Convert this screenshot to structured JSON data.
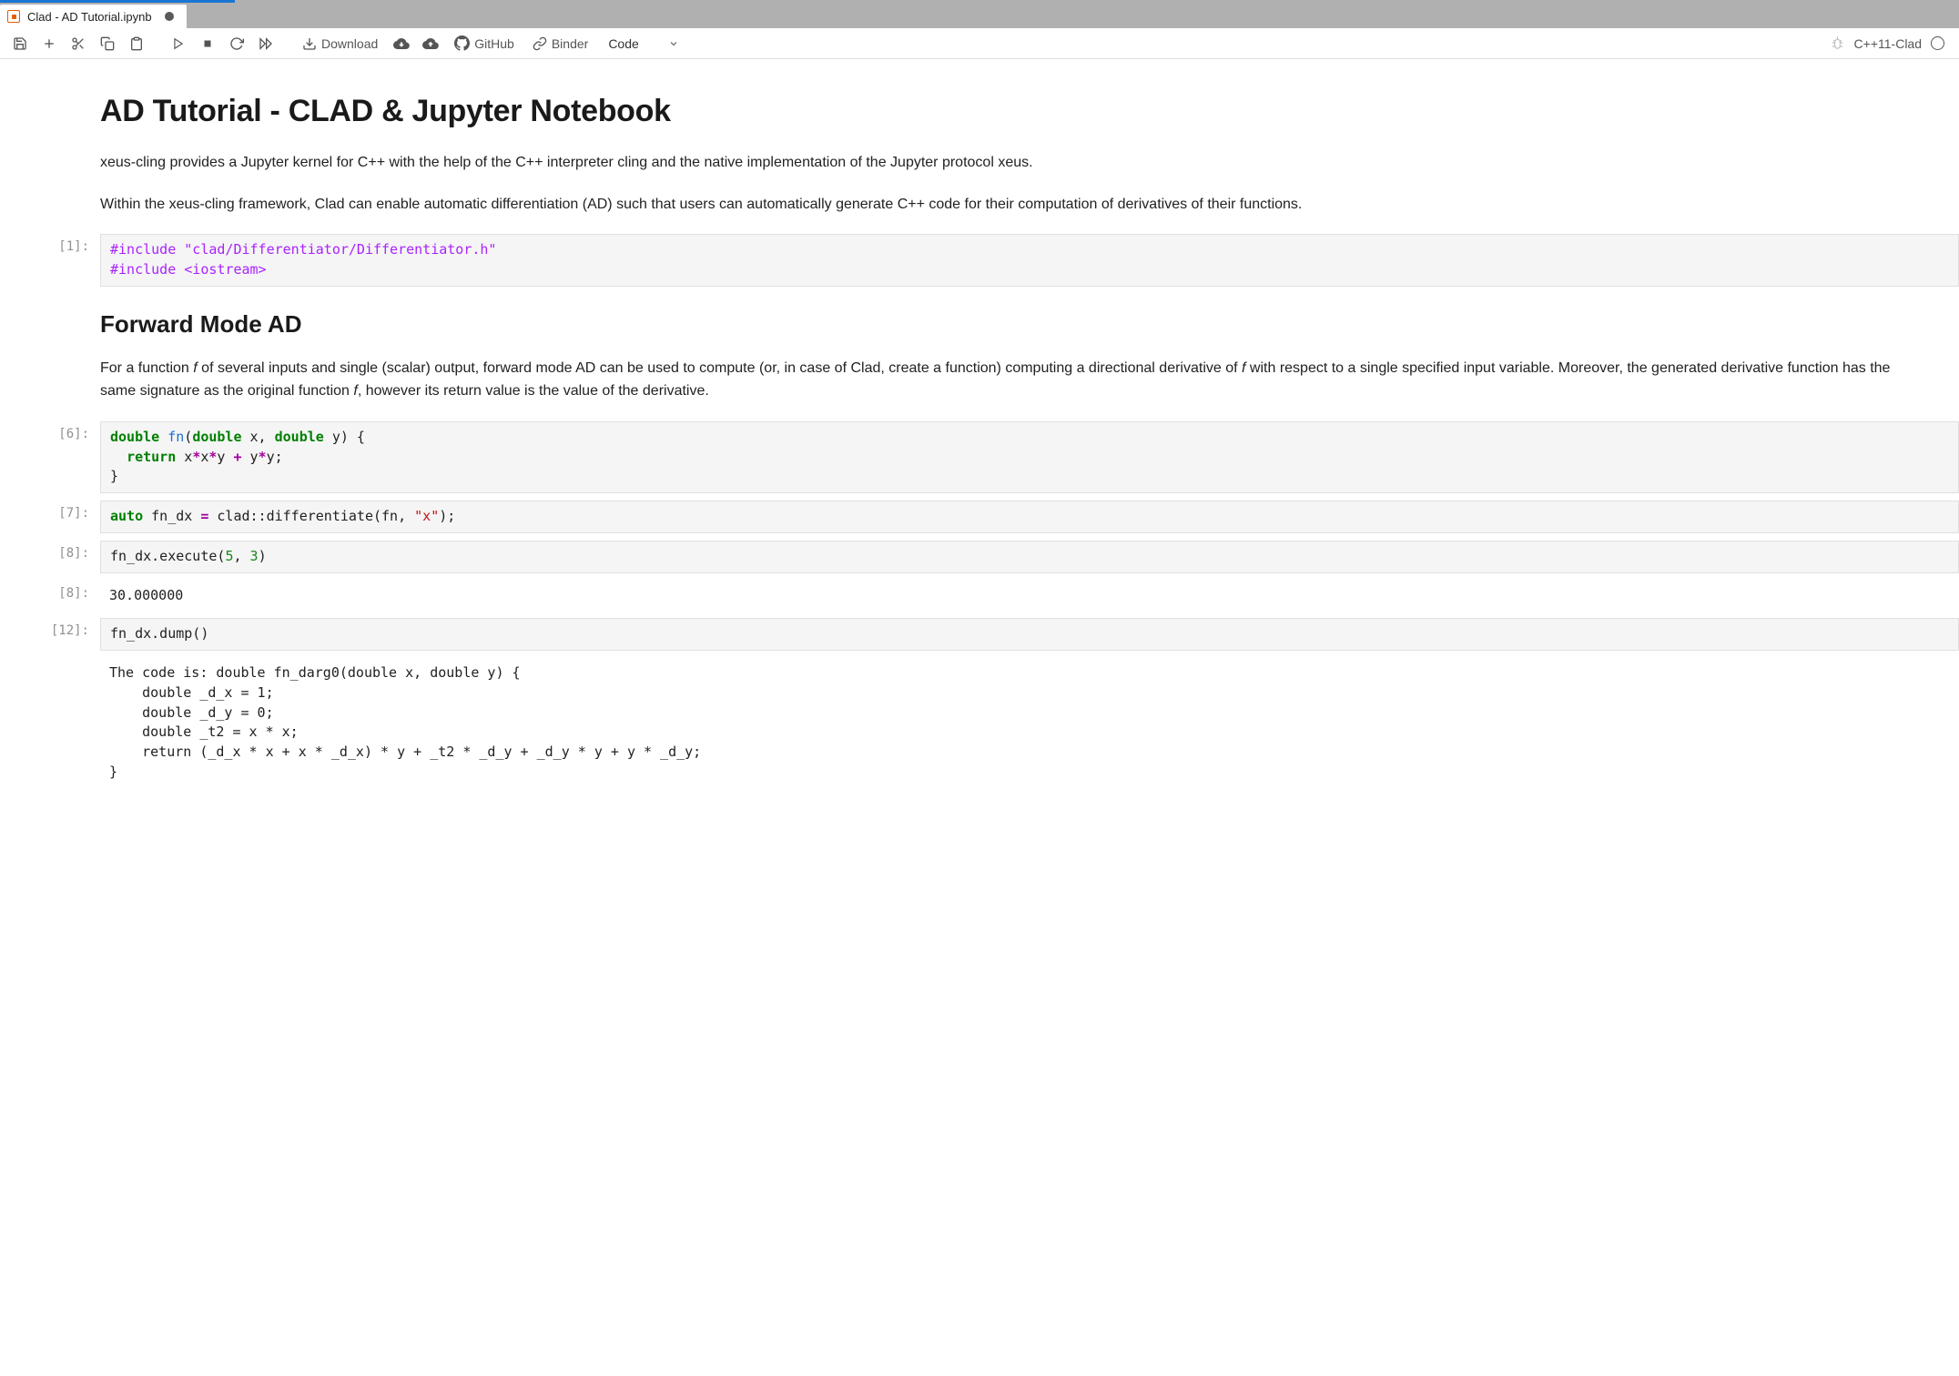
{
  "tab": {
    "title": "Clad - AD Tutorial.ipynb"
  },
  "toolbar": {
    "download": "Download",
    "github": "GitHub",
    "binder": "Binder",
    "celltype": "Code",
    "kernel": "C++11-Clad"
  },
  "content": {
    "h1": "AD Tutorial - CLAD & Jupyter Notebook",
    "p1": "xeus-cling provides a Jupyter kernel for C++ with the help of the C++ interpreter cling and the native implementation of the Jupyter protocol xeus.",
    "p2": "Within the xeus-cling framework, Clad can enable automatic differentiation (AD) such that users can automatically generate C++ code for their computation of derivatives of their functions.",
    "h2": "Forward Mode AD",
    "p3a": "For a function ",
    "p3b": " of several inputs and single (scalar) output, forward mode AD can be used to compute (or, in case of Clad, create a function) computing a directional derivative of ",
    "p3c": " with respect to a single specified input variable. Moreover, the generated derivative function has the same signature as the original function ",
    "p3d": ", however its return value is the value of the derivative.",
    "fn_f": "f"
  },
  "cells": {
    "c1": {
      "prompt": "[1]:",
      "include1": "#include ",
      "include1_str": "\"clad/Differentiator/Differentiator.h\"",
      "include2": "#include ",
      "include2_str": "<iostream>"
    },
    "c6": {
      "prompt": "[6]:",
      "l1a": "double",
      "l1b": " ",
      "l1c": "fn",
      "l1d": "(",
      "l1e": "double",
      "l1f": " x, ",
      "l1g": "double",
      "l1h": " y) {",
      "l2a": "return",
      "l2b": " x",
      "l2c": "*",
      "l2d": "x",
      "l2e": "*",
      "l2f": "y ",
      "l2g": "+",
      "l2h": " y",
      "l2i": "*",
      "l2j": "y;",
      "l3": "}"
    },
    "c7": {
      "prompt": "[7]:",
      "a": "auto",
      "b": " fn_dx ",
      "c": "=",
      "d": " clad::differentiate(fn, ",
      "e": "\"x\"",
      "f": ");"
    },
    "c8": {
      "prompt": "[8]:",
      "a": "fn_dx.execute(",
      "b": "5",
      "c": ", ",
      "d": "3",
      "e": ")"
    },
    "c8out": {
      "prompt": "[8]:",
      "val": "30.000000"
    },
    "c12": {
      "prompt": "[12]:",
      "code": "fn_dx.dump()"
    },
    "c12out": {
      "text": "The code is: double fn_darg0(double x, double y) {\n    double _d_x = 1;\n    double _d_y = 0;\n    double _t2 = x * x;\n    return (_d_x * x + x * _d_x) * y + _t2 * _d_y + _d_y * y + y * _d_y;\n}"
    }
  }
}
